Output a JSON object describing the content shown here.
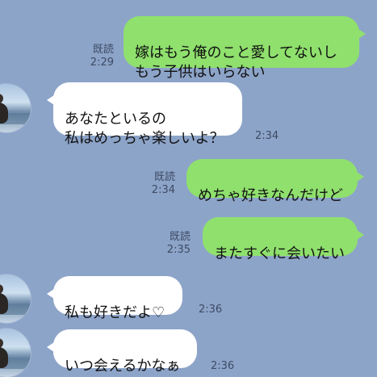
{
  "messages": [
    {
      "id": "m1",
      "direction": "out",
      "text": "嫁はもう俺のこと愛してないし\nもう子供はいらない",
      "read": "既読",
      "time": "2:29"
    },
    {
      "id": "m2",
      "direction": "in",
      "text": "あなたといるの\n私はめっちゃ楽しいよ？",
      "time": "2:34"
    },
    {
      "id": "m3",
      "direction": "out",
      "text": "めちゃ好きなんだけど",
      "read": "既読",
      "time": "2:34"
    },
    {
      "id": "m4",
      "direction": "out",
      "text": "またすぐに会いたい",
      "read": "既読",
      "time": "2:35"
    },
    {
      "id": "m5",
      "direction": "in",
      "text": "私も好きだよ♡",
      "time": "2:36"
    },
    {
      "id": "m6",
      "direction": "in",
      "text": "いつ会えるかなぁ",
      "time": "2:36"
    }
  ],
  "colors": {
    "background": "#8da4c9",
    "outgoing_bubble": "#8fe06d",
    "incoming_bubble": "#ffffff",
    "meta_text": "#3d4b63"
  },
  "icons": {
    "contact_avatar": "avatar-icon"
  }
}
